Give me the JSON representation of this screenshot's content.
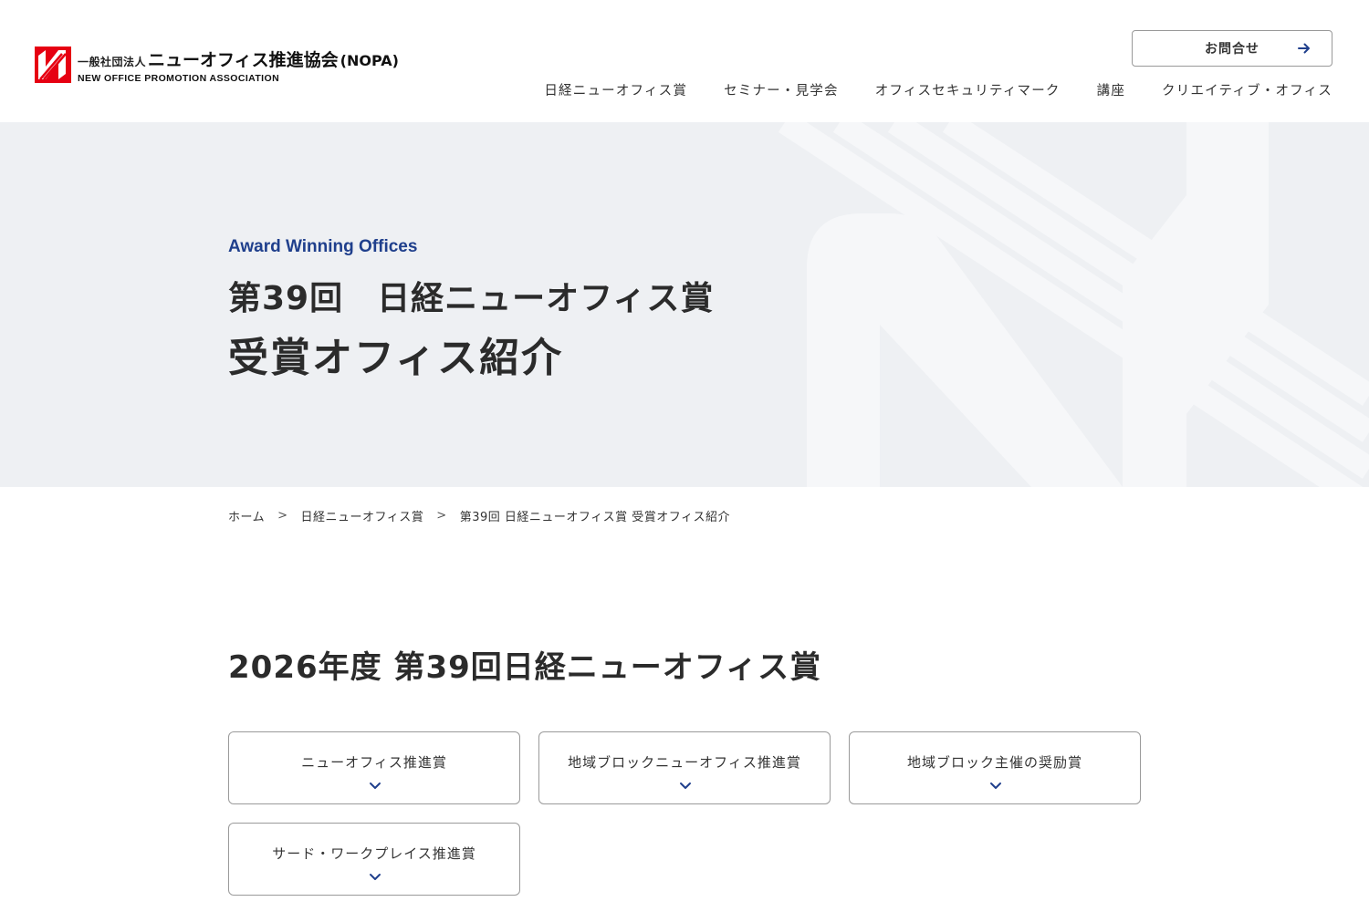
{
  "header": {
    "logo": {
      "prefix": "一般社団法人",
      "name": "ニューオフィス推進協会",
      "abbr": "(NOPA)",
      "english": "NEW OFFICE PROMOTION ASSOCIATION",
      "mark_color": "#e60012"
    },
    "contact_label": "お問合せ",
    "nav": [
      {
        "label": "日経ニューオフィス賞"
      },
      {
        "label": "セミナー・見学会"
      },
      {
        "label": "オフィスセキュリティマーク"
      },
      {
        "label": "講座"
      },
      {
        "label": "クリエイティブ・オフィス"
      }
    ]
  },
  "hero": {
    "eyebrow": "Award Winning Offices",
    "title_line1": "第39回　日経ニューオフィス賞",
    "title_line2": "受賞オフィス紹介",
    "accent": "#1f3f8c"
  },
  "breadcrumb": {
    "items": [
      "ホーム",
      "日経ニューオフィス賞",
      "第39回 日経ニューオフィス賞 受賞オフィス紹介"
    ],
    "separator": ">"
  },
  "section": {
    "title": "2026年度 第39回日経ニューオフィス賞",
    "cards": [
      {
        "label": "ニューオフィス推進賞"
      },
      {
        "label": "地域ブロックニューオフィス推進賞"
      },
      {
        "label": "地域ブロック主催の奨励賞"
      },
      {
        "label": "サード・ワークプレイス推進賞"
      }
    ]
  }
}
